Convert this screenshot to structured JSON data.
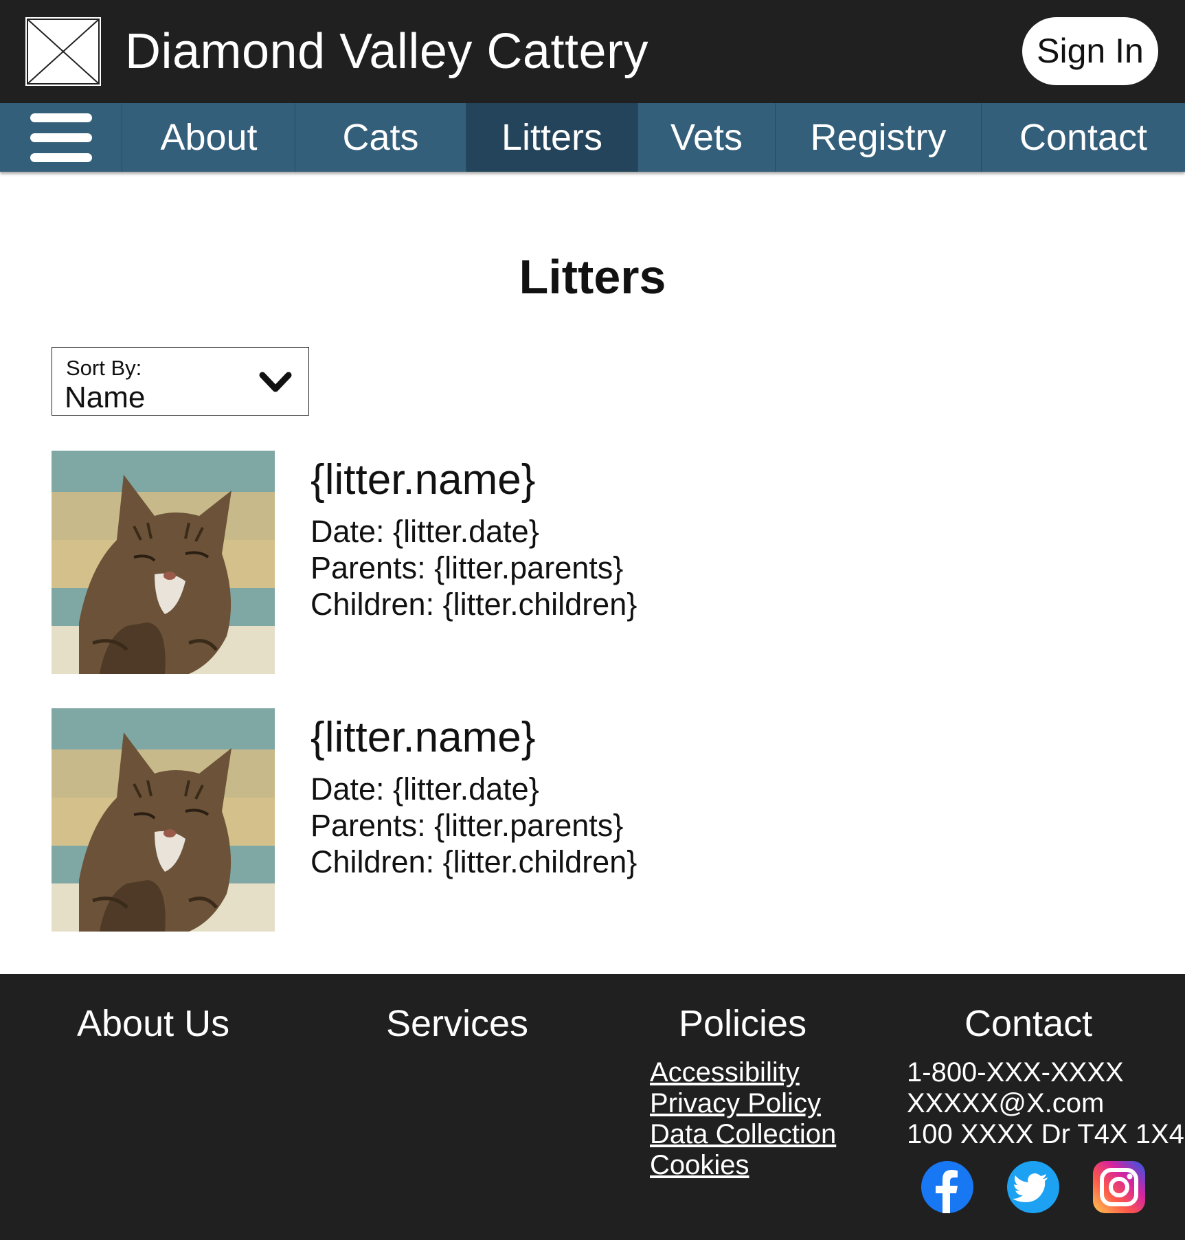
{
  "header": {
    "title": "Diamond Valley Cattery",
    "sign_in_label": "Sign In"
  },
  "nav": {
    "items": [
      {
        "label": "About"
      },
      {
        "label": "Cats"
      },
      {
        "label": "Litters",
        "active": true
      },
      {
        "label": "Vets"
      },
      {
        "label": "Registry"
      },
      {
        "label": "Contact"
      }
    ]
  },
  "main": {
    "title": "Litters",
    "sort": {
      "label": "Sort By:",
      "value": "Name"
    },
    "litters": [
      {
        "name": "{litter.name}",
        "date": "Date: {litter.date}",
        "parents": "Parents: {litter.parents}",
        "children": "Children: {litter.children}"
      },
      {
        "name": "{litter.name}",
        "date": "Date: {litter.date}",
        "parents": "Parents: {litter.parents}",
        "children": "Children: {litter.children}"
      }
    ]
  },
  "footer": {
    "headings": {
      "about": "About Us",
      "services": "Services",
      "policies": "Policies",
      "contact": "Contact"
    },
    "policy_links": [
      "Accessibility",
      "Privacy Policy",
      "Data Collection",
      "Cookies"
    ],
    "contact": {
      "phone": "1-800-XXX-XXXX",
      "email": "XXXXX@X.com",
      "address": "100 XXXX Dr T4X 1X4"
    },
    "social_icons": [
      "facebook-icon",
      "twitter-icon",
      "instagram-icon"
    ]
  },
  "colors": {
    "header_bg": "#202020",
    "nav_bg": "#345f7a",
    "nav_active_bg": "#23445a",
    "footer_bg": "#202020",
    "facebook": "#1877f2",
    "twitter": "#1da1f2"
  }
}
